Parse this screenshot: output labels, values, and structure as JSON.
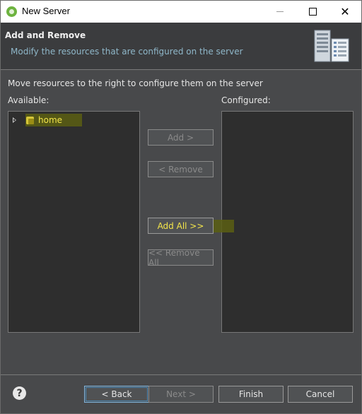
{
  "window": {
    "title": "New Server",
    "icons": {
      "app": "spring-leaf-icon",
      "minimize": "minimize-icon",
      "maximize": "maximize-icon",
      "close": "close-icon"
    }
  },
  "header": {
    "title": "Add and Remove",
    "description": "Modify the resources that are configured on the server",
    "image_icon": "server-graphic-icon"
  },
  "instructions": "Move resources to the right to configure them on the server",
  "available": {
    "label": "Available:",
    "items": [
      {
        "label": "home",
        "icon": "project-folder-icon",
        "expand_icon": "expand-triangle-icon",
        "highlighted": true
      }
    ]
  },
  "configured": {
    "label": "Configured:",
    "items": []
  },
  "buttons": {
    "add": "Add >",
    "remove": "< Remove",
    "add_all": "Add All >>",
    "remove_all": "<< Remove All"
  },
  "footer": {
    "help_icon": "help-icon",
    "back": "< Back",
    "next": "Next >",
    "finish": "Finish",
    "cancel": "Cancel"
  },
  "colors": {
    "dialog_bg": "#48494b",
    "header_desc": "#8fb7c9",
    "highlight_text": "#f3e54a",
    "list_bg": "#2e2e2e"
  }
}
